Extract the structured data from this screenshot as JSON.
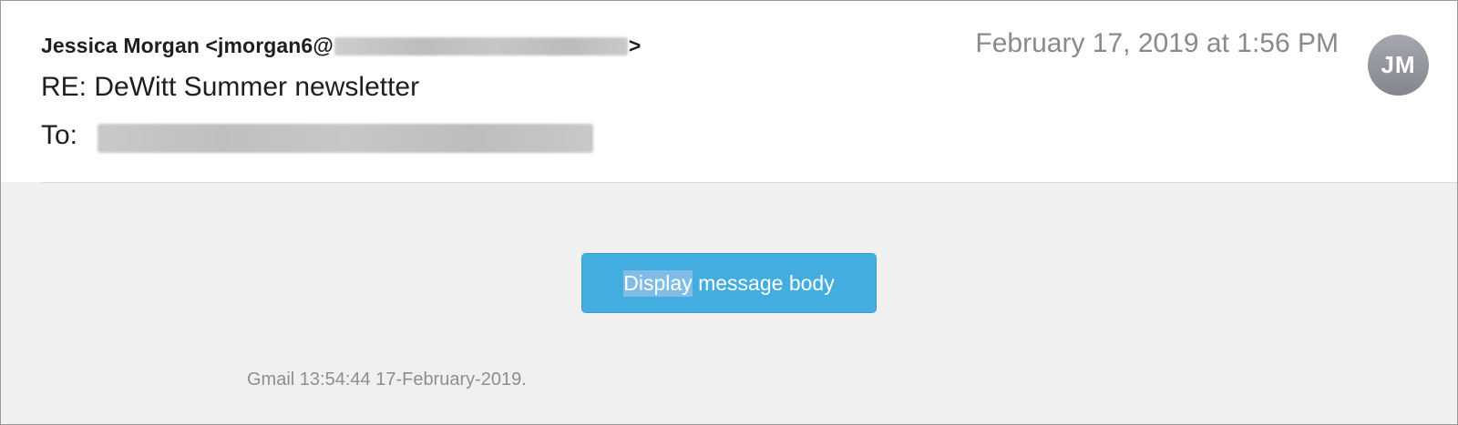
{
  "message": {
    "from_name_prefix": "Jessica Morgan <jmorgan6@",
    "from_suffix": ">",
    "subject": "RE: DeWitt Summer newsletter",
    "to_label": "To:",
    "date": "February 17, 2019 at 1:56 PM",
    "avatar_initials": "JM"
  },
  "body": {
    "button_highlighted": "Display",
    "button_rest": " message body",
    "footer": "Gmail 13:54:44 17-February-2019."
  },
  "colors": {
    "button": "#43ade0",
    "avatar": "#8f9198",
    "body_background": "#f0f0f0"
  }
}
